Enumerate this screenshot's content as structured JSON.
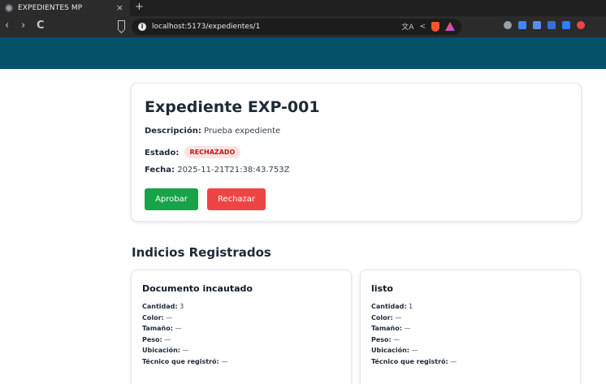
{
  "browser": {
    "tab_title": "EXPEDIENTES MP",
    "tab_close": "×",
    "new_tab": "+",
    "url": "localhost:5173/expedientes/1",
    "back": "‹",
    "forward": "›",
    "reload": "C"
  },
  "expediente": {
    "title": "Expediente EXP-001",
    "descripcion_label": "Descripción:",
    "descripcion": "Prueba expediente",
    "estado_label": "Estado:",
    "estado": "RECHAZADO",
    "fecha_label": "Fecha:",
    "fecha": "2025-11-21T21:38:43.753Z",
    "approve_label": "Aprobar",
    "reject_label": "Rechazar"
  },
  "indicios": {
    "section_title": "Indicios Registrados",
    "labels": {
      "cantidad": "Cantidad:",
      "color": "Color:",
      "tamano": "Tamaño:",
      "peso": "Peso:",
      "ubicacion": "Ubicación:",
      "tecnico": "Técnico que registró:"
    },
    "items": [
      {
        "name": "Documento incautado",
        "cantidad": "3",
        "color": "—",
        "tamano": "—",
        "peso": "—",
        "ubicacion": "—",
        "tecnico": "—"
      },
      {
        "name": "listo",
        "cantidad": "1",
        "color": "—",
        "tamano": "—",
        "peso": "—",
        "ubicacion": "—",
        "tecnico": "—"
      }
    ]
  },
  "colors": {
    "appbar": "#05516a",
    "approve": "#16a34a",
    "reject": "#ef4444",
    "badge_bg": "#fde2e2",
    "badge_text": "#b91c1c"
  }
}
